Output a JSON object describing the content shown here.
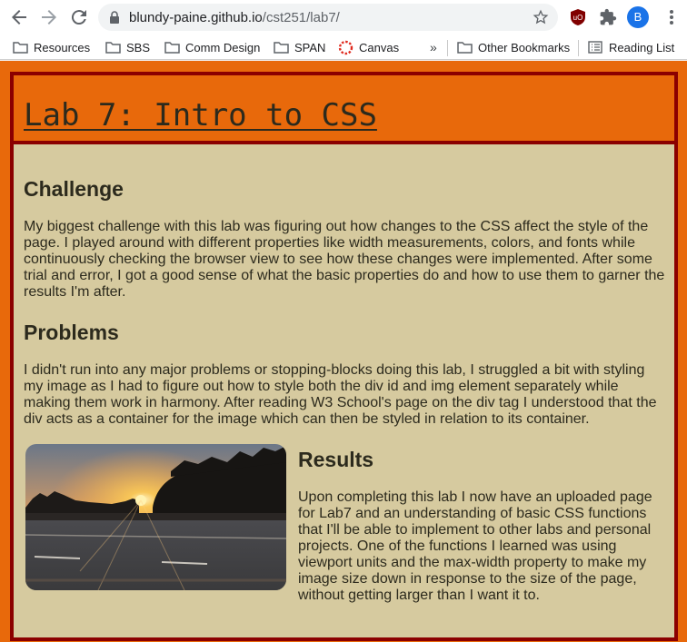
{
  "browser": {
    "url_host": "blundy-paine.github.io",
    "url_path": "/cst251/lab7/",
    "profile_initial": "B",
    "bookmarks": [
      {
        "label": "Resources"
      },
      {
        "label": "SBS"
      },
      {
        "label": "Comm Design"
      },
      {
        "label": "SPAN"
      },
      {
        "label": "Canvas"
      },
      {
        "label": "Other Bookmarks"
      },
      {
        "label": "Reading List"
      }
    ],
    "overflow_label": "»"
  },
  "page": {
    "title": "Lab 7: Intro to CSS",
    "sections": [
      {
        "heading": "Challenge",
        "body": "My biggest challenge with this lab was figuring out how changes to the CSS affect the style of the page. I played around with different properties like width measurements, colors, and fonts while continuously checking the browser view to see how these changes were implemented. After some trial and error, I got a good sense of what the basic properties do and how to use them to garner the results I'm after."
      },
      {
        "heading": "Problems",
        "body": "I didn't run into any major problems or stopping-blocks doing this lab, I struggled a bit with styling my image as I had to figure out how to style both the div id and img element separately while making them work in harmony. After reading W3 School's page on the div tag I understood that the div acts as a container for the image which can then be styled in relation to its container."
      },
      {
        "heading": "Results",
        "body": "Upon completing this lab I now have an uploaded page for Lab7 and an understanding of basic CSS functions that I'll be able to implement to other labs and personal projects. One of the functions I learned was using viewport units and the max-width property to make my image size down in response to the size of the page, without getting larger than I want it to."
      }
    ]
  },
  "colors": {
    "page_orange": "#e8690b",
    "border_red": "#8b0000",
    "content_tan": "#d6ca9f",
    "text_dark": "#2c2a1d"
  },
  "icons": [
    "back-icon",
    "forward-icon",
    "reload-icon",
    "lock-icon",
    "bookmark-star-icon",
    "ublock-icon",
    "extensions-icon",
    "menu-icon",
    "folder-icon",
    "canvas-icon",
    "reading-list-icon"
  ]
}
